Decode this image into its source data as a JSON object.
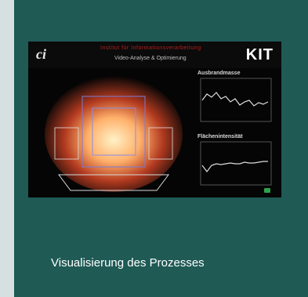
{
  "thumbnail": {
    "logo_left": "ci",
    "logo_right": "KIT",
    "header_red": "Institut für Informationsverarbeitung",
    "header_sub": "Video-Analyse & Optimierung",
    "panel_top_title": "Ausbrandmasse",
    "panel_bottom_title": "Flächenintensität"
  },
  "caption": "Visualisierung des Prozesses",
  "colors": {
    "card": "#1f5a55",
    "edge": "#d6e0e0",
    "text": "#ffffff"
  }
}
